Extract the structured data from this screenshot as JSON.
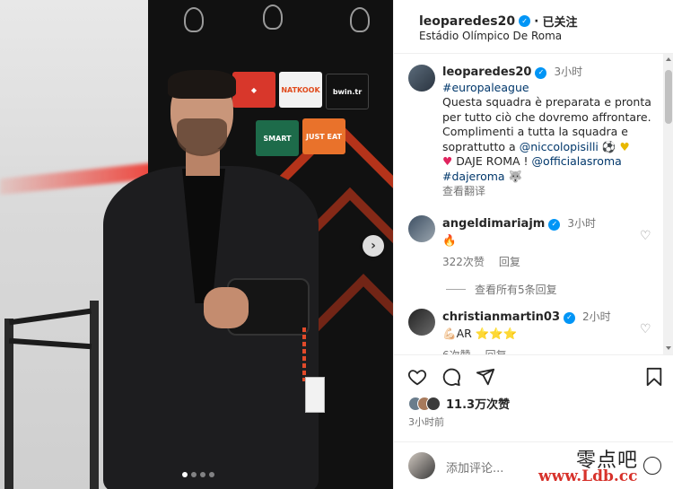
{
  "post": {
    "username": "leoparedes20",
    "follow_separator": "·",
    "follow_state": "已关注",
    "location": "Estádio Olímpico De Roma",
    "carousel": {
      "total_slides": 4,
      "active_slide": 1,
      "next_icon": "chevron-right-icon"
    },
    "sponsors": [
      "bwin.tr",
      "NATKOOK",
      "SMART",
      "JUST EAT"
    ]
  },
  "caption": {
    "username": "leoparedes20",
    "time": "3小时",
    "hashtag1": "#europaleague",
    "text1": "Questa squadra è preparata e pronta per tutto ciò che dovremo affrontare. Complimenti a tutta la squadra e soprattutto a",
    "mention1": "@niccolopisilli",
    "text2": "DAJE ROMA !",
    "mention2": "@officialasroma",
    "hashtag2": "#dajeroma",
    "see_translation": "查看翻译"
  },
  "comments": [
    {
      "username": "angeldimariajm",
      "time": "3小时",
      "text": "🔥",
      "likes": "322次赞",
      "reply_label": "回复",
      "view_replies": "查看所有5条回复"
    },
    {
      "username": "christianmartin03",
      "time": "2小时",
      "text": "💪🏻AR ⭐⭐⭐",
      "likes": "6次赞",
      "reply_label": "回复"
    }
  ],
  "actions": {
    "like_icon": "heart-icon",
    "comment_icon": "comment-icon",
    "share_icon": "send-icon",
    "save_icon": "bookmark-icon"
  },
  "likes_summary": "11.3万次赞",
  "posted_ago": "3小时前",
  "add_comment_placeholder": "添加评论...",
  "watermark": {
    "cn": "零点吧",
    "url": "www.Ldb.cc"
  },
  "colors": {
    "link": "#00376b",
    "verified": "#0095f6",
    "muted": "#737373",
    "accent_red": "#d23a1c"
  }
}
